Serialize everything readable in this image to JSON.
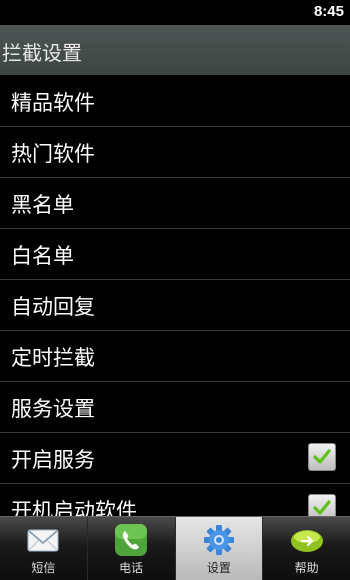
{
  "status_bar": {
    "time": "8:45"
  },
  "title_bar": {
    "title": "拦截设置"
  },
  "list": [
    {
      "label": "精品软件",
      "checkbox": false
    },
    {
      "label": "热门软件",
      "checkbox": false
    },
    {
      "label": "黑名单",
      "checkbox": false
    },
    {
      "label": "白名单",
      "checkbox": false
    },
    {
      "label": "自动回复",
      "checkbox": false
    },
    {
      "label": "定时拦截",
      "checkbox": false
    },
    {
      "label": "服务设置",
      "checkbox": false
    },
    {
      "label": "开启服务",
      "checkbox": true,
      "checked": true
    },
    {
      "label": "开机启动软件",
      "checkbox": true,
      "checked": true
    }
  ],
  "tabs": [
    {
      "label": "短信",
      "icon": "envelope-icon",
      "active": false
    },
    {
      "label": "电话",
      "icon": "phone-icon",
      "active": false
    },
    {
      "label": "设置",
      "icon": "gear-icon",
      "active": true
    },
    {
      "label": "帮助",
      "icon": "help-icon",
      "active": false
    }
  ],
  "colors": {
    "background": "#000000",
    "title_bar": "#444c4a",
    "check_green": "#5cc21a",
    "active_tab": "#d0d0d0"
  }
}
